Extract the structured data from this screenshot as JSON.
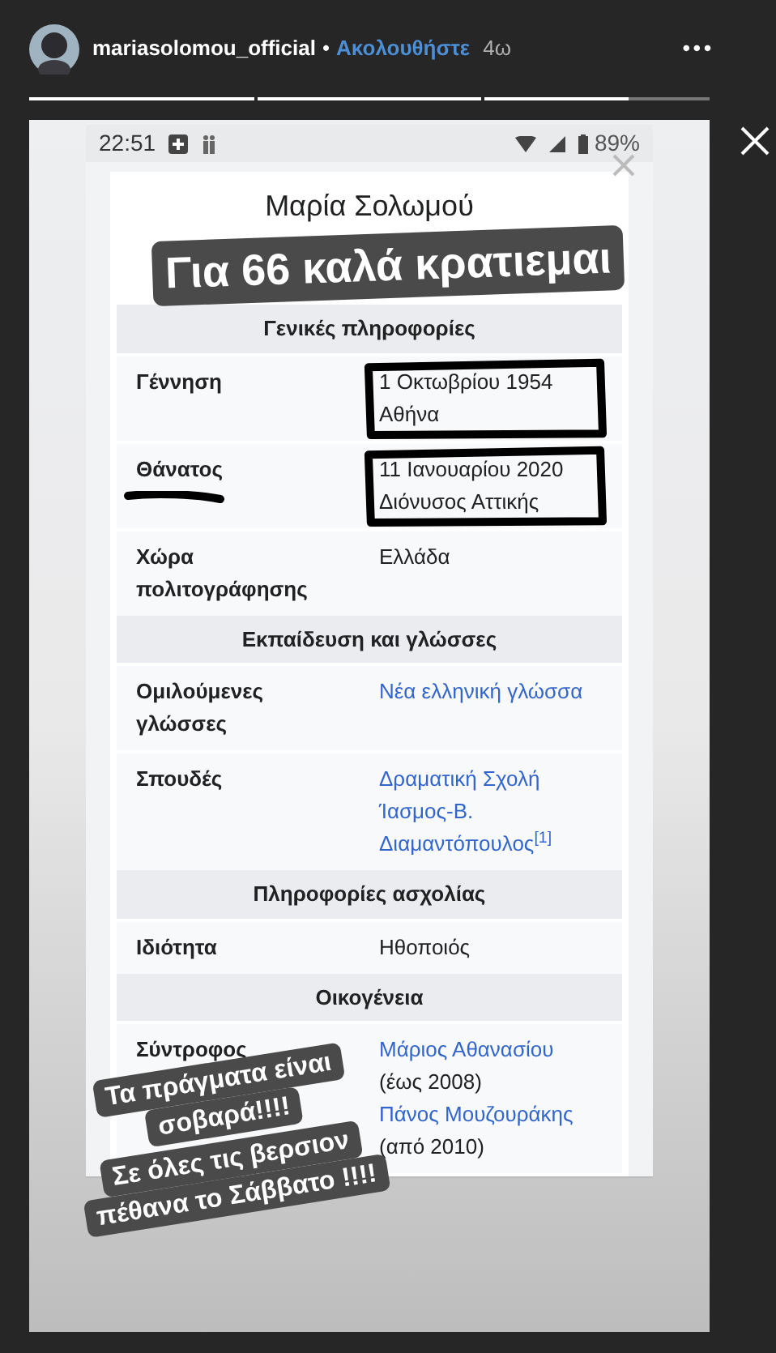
{
  "header": {
    "username": "mariasolomou_official",
    "separator": "•",
    "follow": "Ακολουθήστε",
    "age": "4ω",
    "more": "•••"
  },
  "progress": [
    {
      "level": 1
    },
    {
      "level": 1
    },
    {
      "level": 0.64
    }
  ],
  "phone": {
    "time": "22:51",
    "battery": "89%"
  },
  "infobox": {
    "title": "Μαρία Σολωμού",
    "sections": [
      {
        "heading": "Γενικές πληροφορίες",
        "rows": [
          {
            "label": [
              "Γέννηση"
            ],
            "underlined": false,
            "circled": true,
            "lines": [
              {
                "text": "1 Οκτωβρίου 1954",
                "link": false
              },
              {
                "text": "Αθήνα",
                "link": false
              }
            ]
          },
          {
            "label": [
              "Θάνατος"
            ],
            "underlined": true,
            "circled": true,
            "lines": [
              {
                "text": "11 Ιανουαρίου 2020",
                "link": false
              },
              {
                "text": "Διόνυσος Αττικής",
                "link": false
              }
            ]
          },
          {
            "label": [
              "Χώρα",
              "πολιτογράφησης"
            ],
            "lines": [
              {
                "text": "Ελλάδα",
                "link": false
              }
            ]
          }
        ]
      },
      {
        "heading": "Εκπαίδευση και γλώσσες",
        "rows": [
          {
            "label": [
              "Ομιλούμενες",
              "γλώσσες"
            ],
            "lines": [
              {
                "text": "Νέα ελληνική γλώσσα",
                "link": true
              }
            ]
          },
          {
            "label": [
              "Σπουδές"
            ],
            "lines": [
              {
                "text": "Δραματική Σχολή",
                "link": true
              },
              {
                "text": "Ίασμος-Β.",
                "link": true
              },
              {
                "text": "Διαμαντόπουλος$^{[1]}$",
                "link": true
              }
            ]
          }
        ]
      },
      {
        "heading": "Πληροφορίες ασχολίας",
        "rows": [
          {
            "label": [
              "Ιδιότητα"
            ],
            "lines": [
              {
                "text": "Ηθοποιός",
                "link": false
              }
            ]
          }
        ]
      },
      {
        "heading": "Οικογένεια",
        "rows": [
          {
            "label": [
              "Σύντροφος"
            ],
            "lines": [
              {
                "text": "Μάριος Αθανασίου",
                "link": true
              },
              {
                "text": "(έως 2008)",
                "link": false
              },
              {
                "text": "Πάνος Μουζουράκης",
                "link": true
              },
              {
                "text": "(από 2010)",
                "link": false
              }
            ]
          }
        ]
      }
    ]
  },
  "stickers": [
    {
      "lines": [
        "Για 66 καλά κρατιεμαι"
      ]
    },
    {
      "lines": [
        "Τα πράγματα είναι",
        "σοβαρά!!!!"
      ]
    },
    {
      "lines": [
        "Σε όλες τις βερσιον",
        "πέθανα το Σάββατο !!!!"
      ]
    }
  ]
}
